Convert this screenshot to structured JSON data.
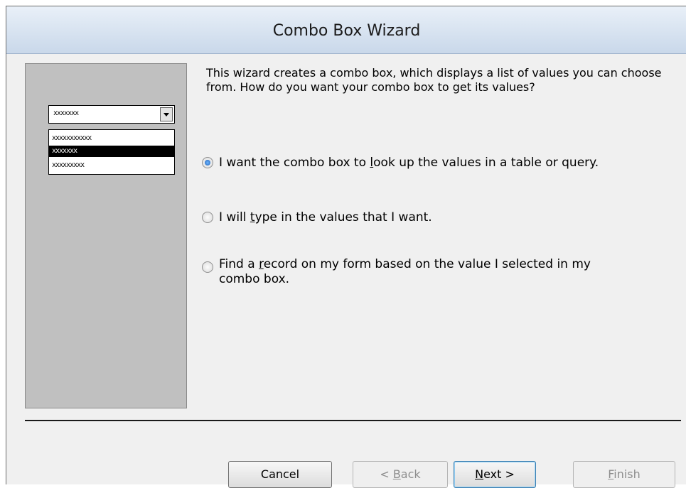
{
  "window": {
    "title": "Combo Box Wizard"
  },
  "preview": {
    "combo_value": "xxxxxxx",
    "list_items": [
      {
        "text": "xxxxxxxxxxx",
        "selected": false
      },
      {
        "text": "xxxxxxx",
        "selected": true
      },
      {
        "text": "xxxxxxxxx",
        "selected": false
      }
    ]
  },
  "intro_text": "This wizard creates a combo box, which displays a list of values you can choose from.  How do you want your combo box to get its values?",
  "options": [
    {
      "label": "I want the combo box to look up the values in a table or query.",
      "accel": "l",
      "checked": true
    },
    {
      "label": "I will type in the values that I want.",
      "accel": "t",
      "checked": false
    },
    {
      "label": "Find a record on my form based on the value I selected in my combo box.",
      "accel": "r",
      "checked": false
    }
  ],
  "buttons": {
    "cancel": "Cancel",
    "back": "< Back",
    "next": "Next >",
    "finish": "Finish"
  }
}
